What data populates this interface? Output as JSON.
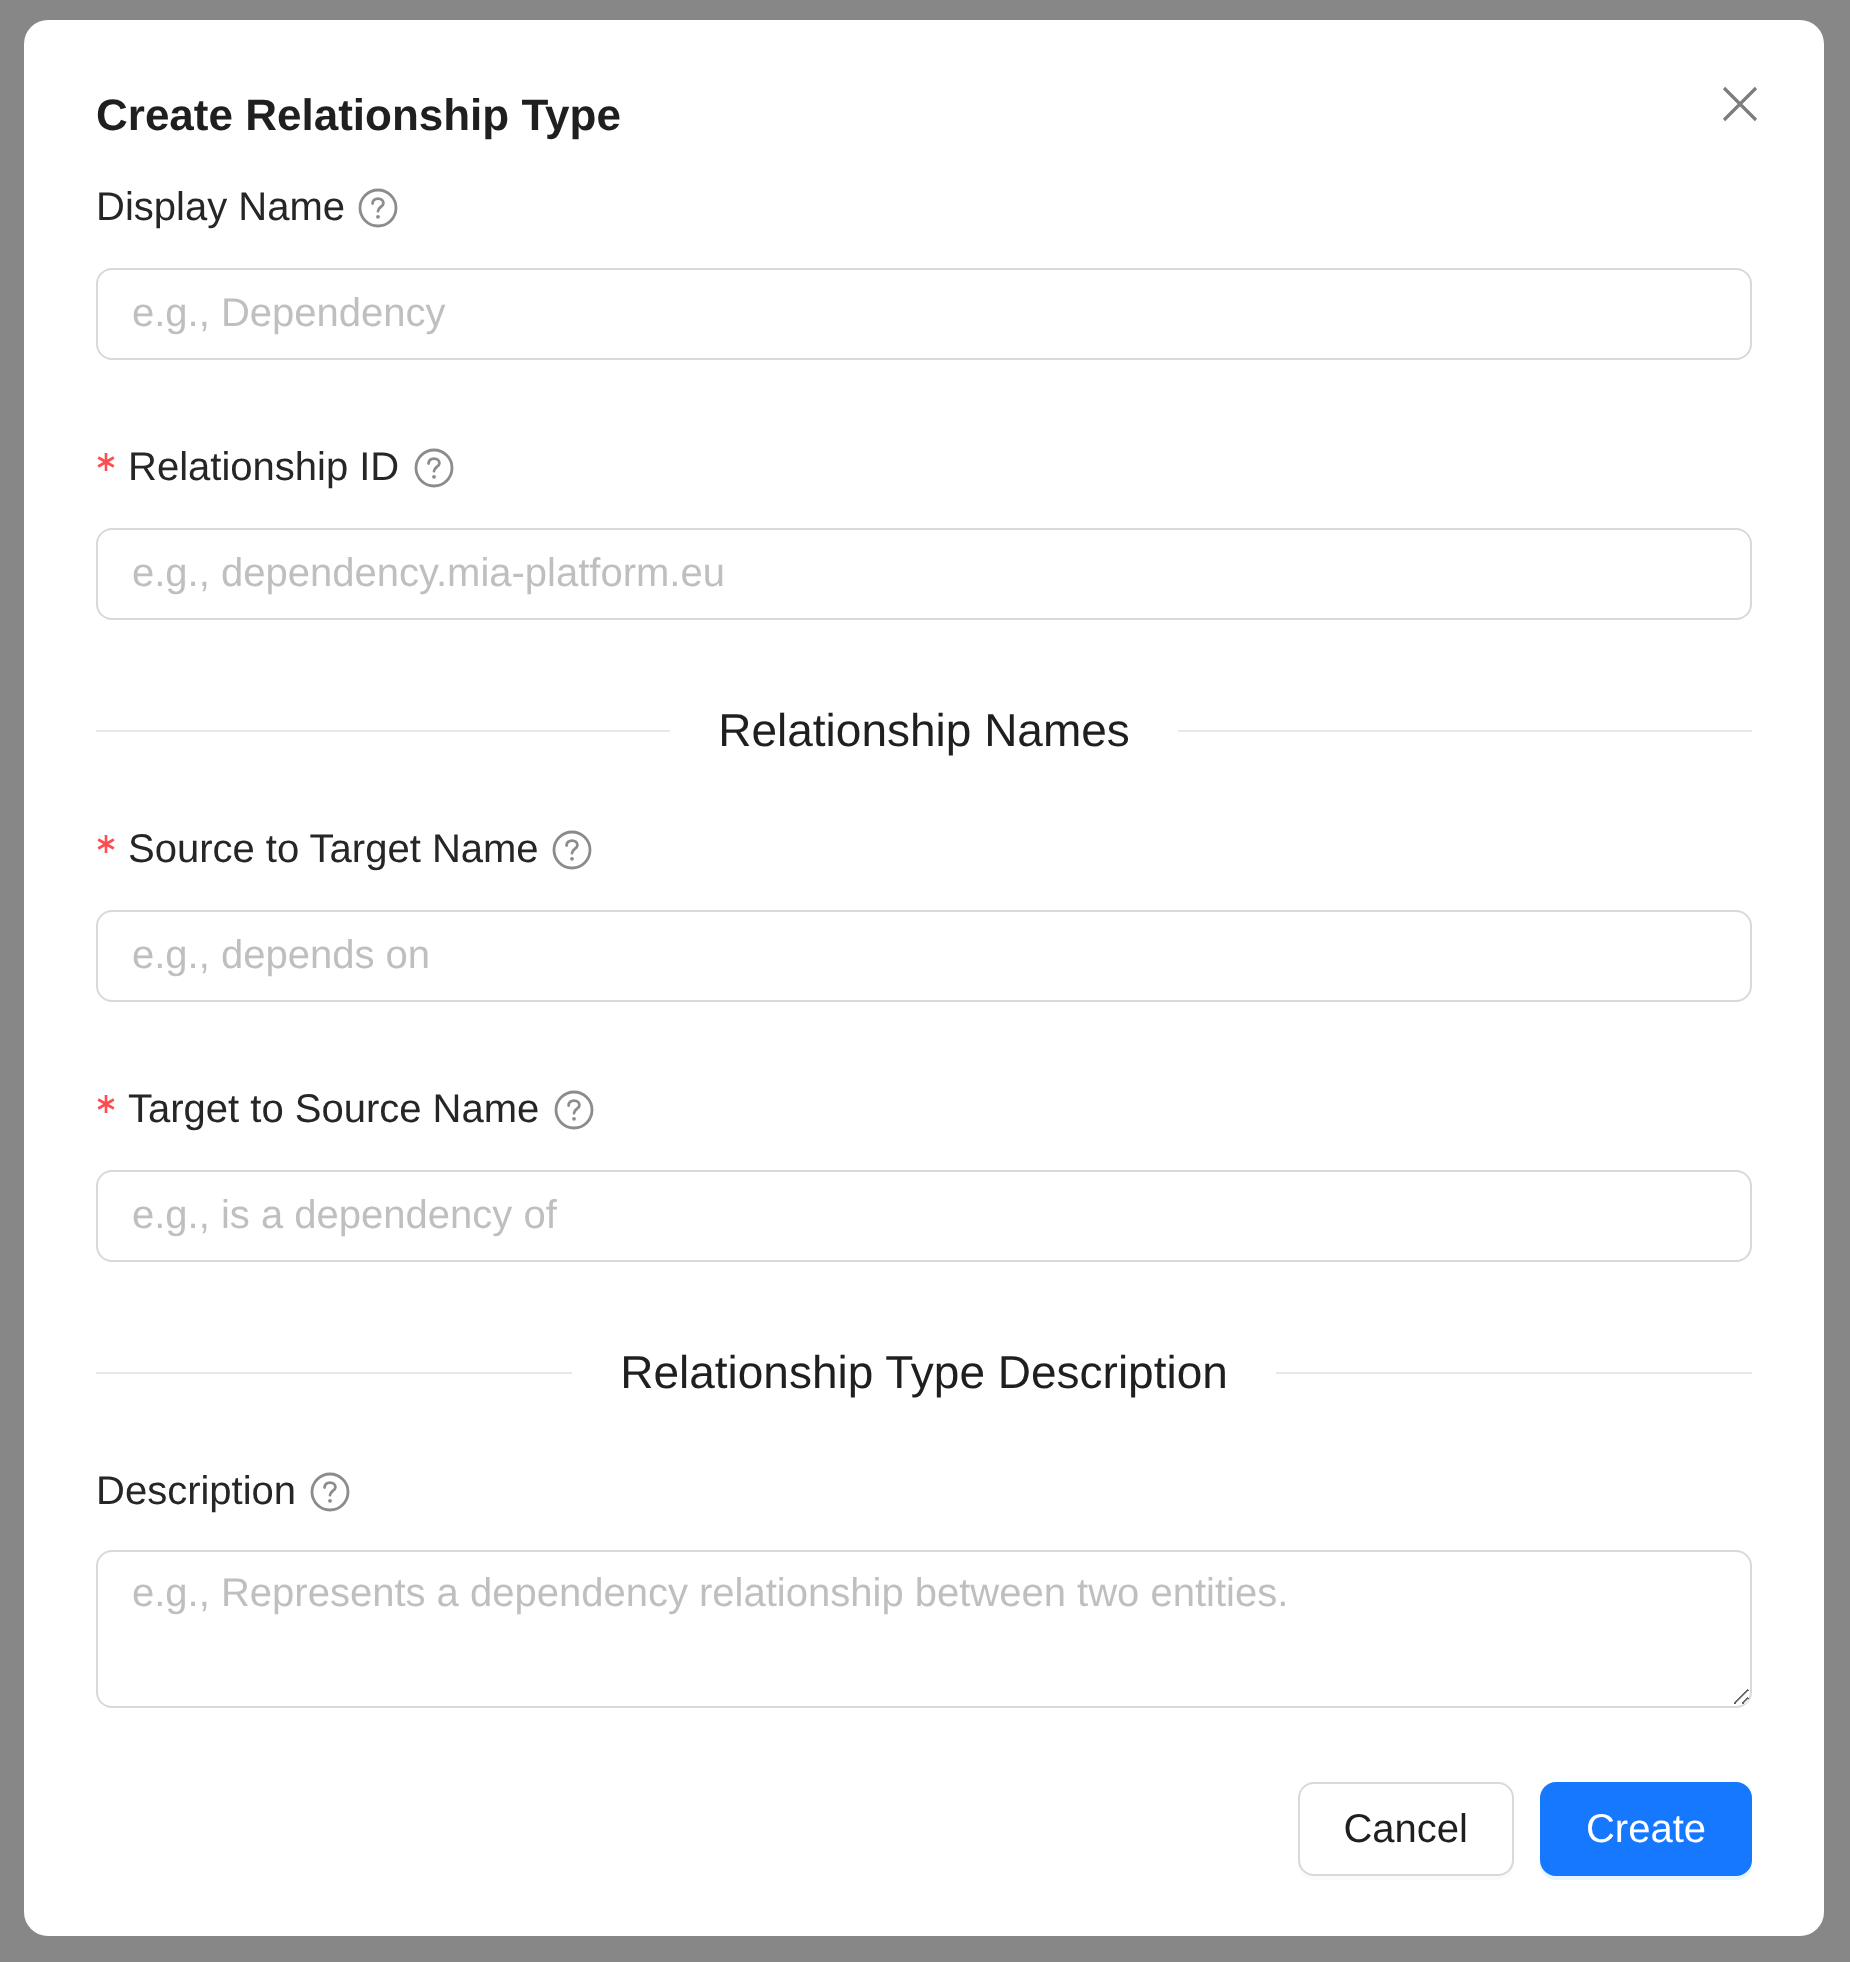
{
  "dialog": {
    "title": "Create Relationship Type"
  },
  "form": [
    {
      "kind": "input",
      "label": "Display Name",
      "required": false,
      "placeholder": "e.g., Dependency"
    },
    {
      "kind": "input",
      "label": "Relationship ID",
      "required": true,
      "placeholder": "e.g., dependency.mia-platform.eu"
    },
    {
      "kind": "divider",
      "label": "Relationship Names"
    },
    {
      "kind": "input",
      "label": "Source to Target Name",
      "required": true,
      "placeholder": "e.g., depends on"
    },
    {
      "kind": "input",
      "label": "Target to Source Name",
      "required": true,
      "placeholder": "e.g., is a dependency of"
    },
    {
      "kind": "divider",
      "label": "Relationship Type Description"
    },
    {
      "kind": "textarea",
      "label": "Description",
      "required": false,
      "placeholder": "e.g., Represents a dependency relationship between two entities."
    }
  ],
  "buttons": [
    {
      "label": "Cancel",
      "kind": "default"
    },
    {
      "label": "Create",
      "kind": "primary"
    }
  ]
}
